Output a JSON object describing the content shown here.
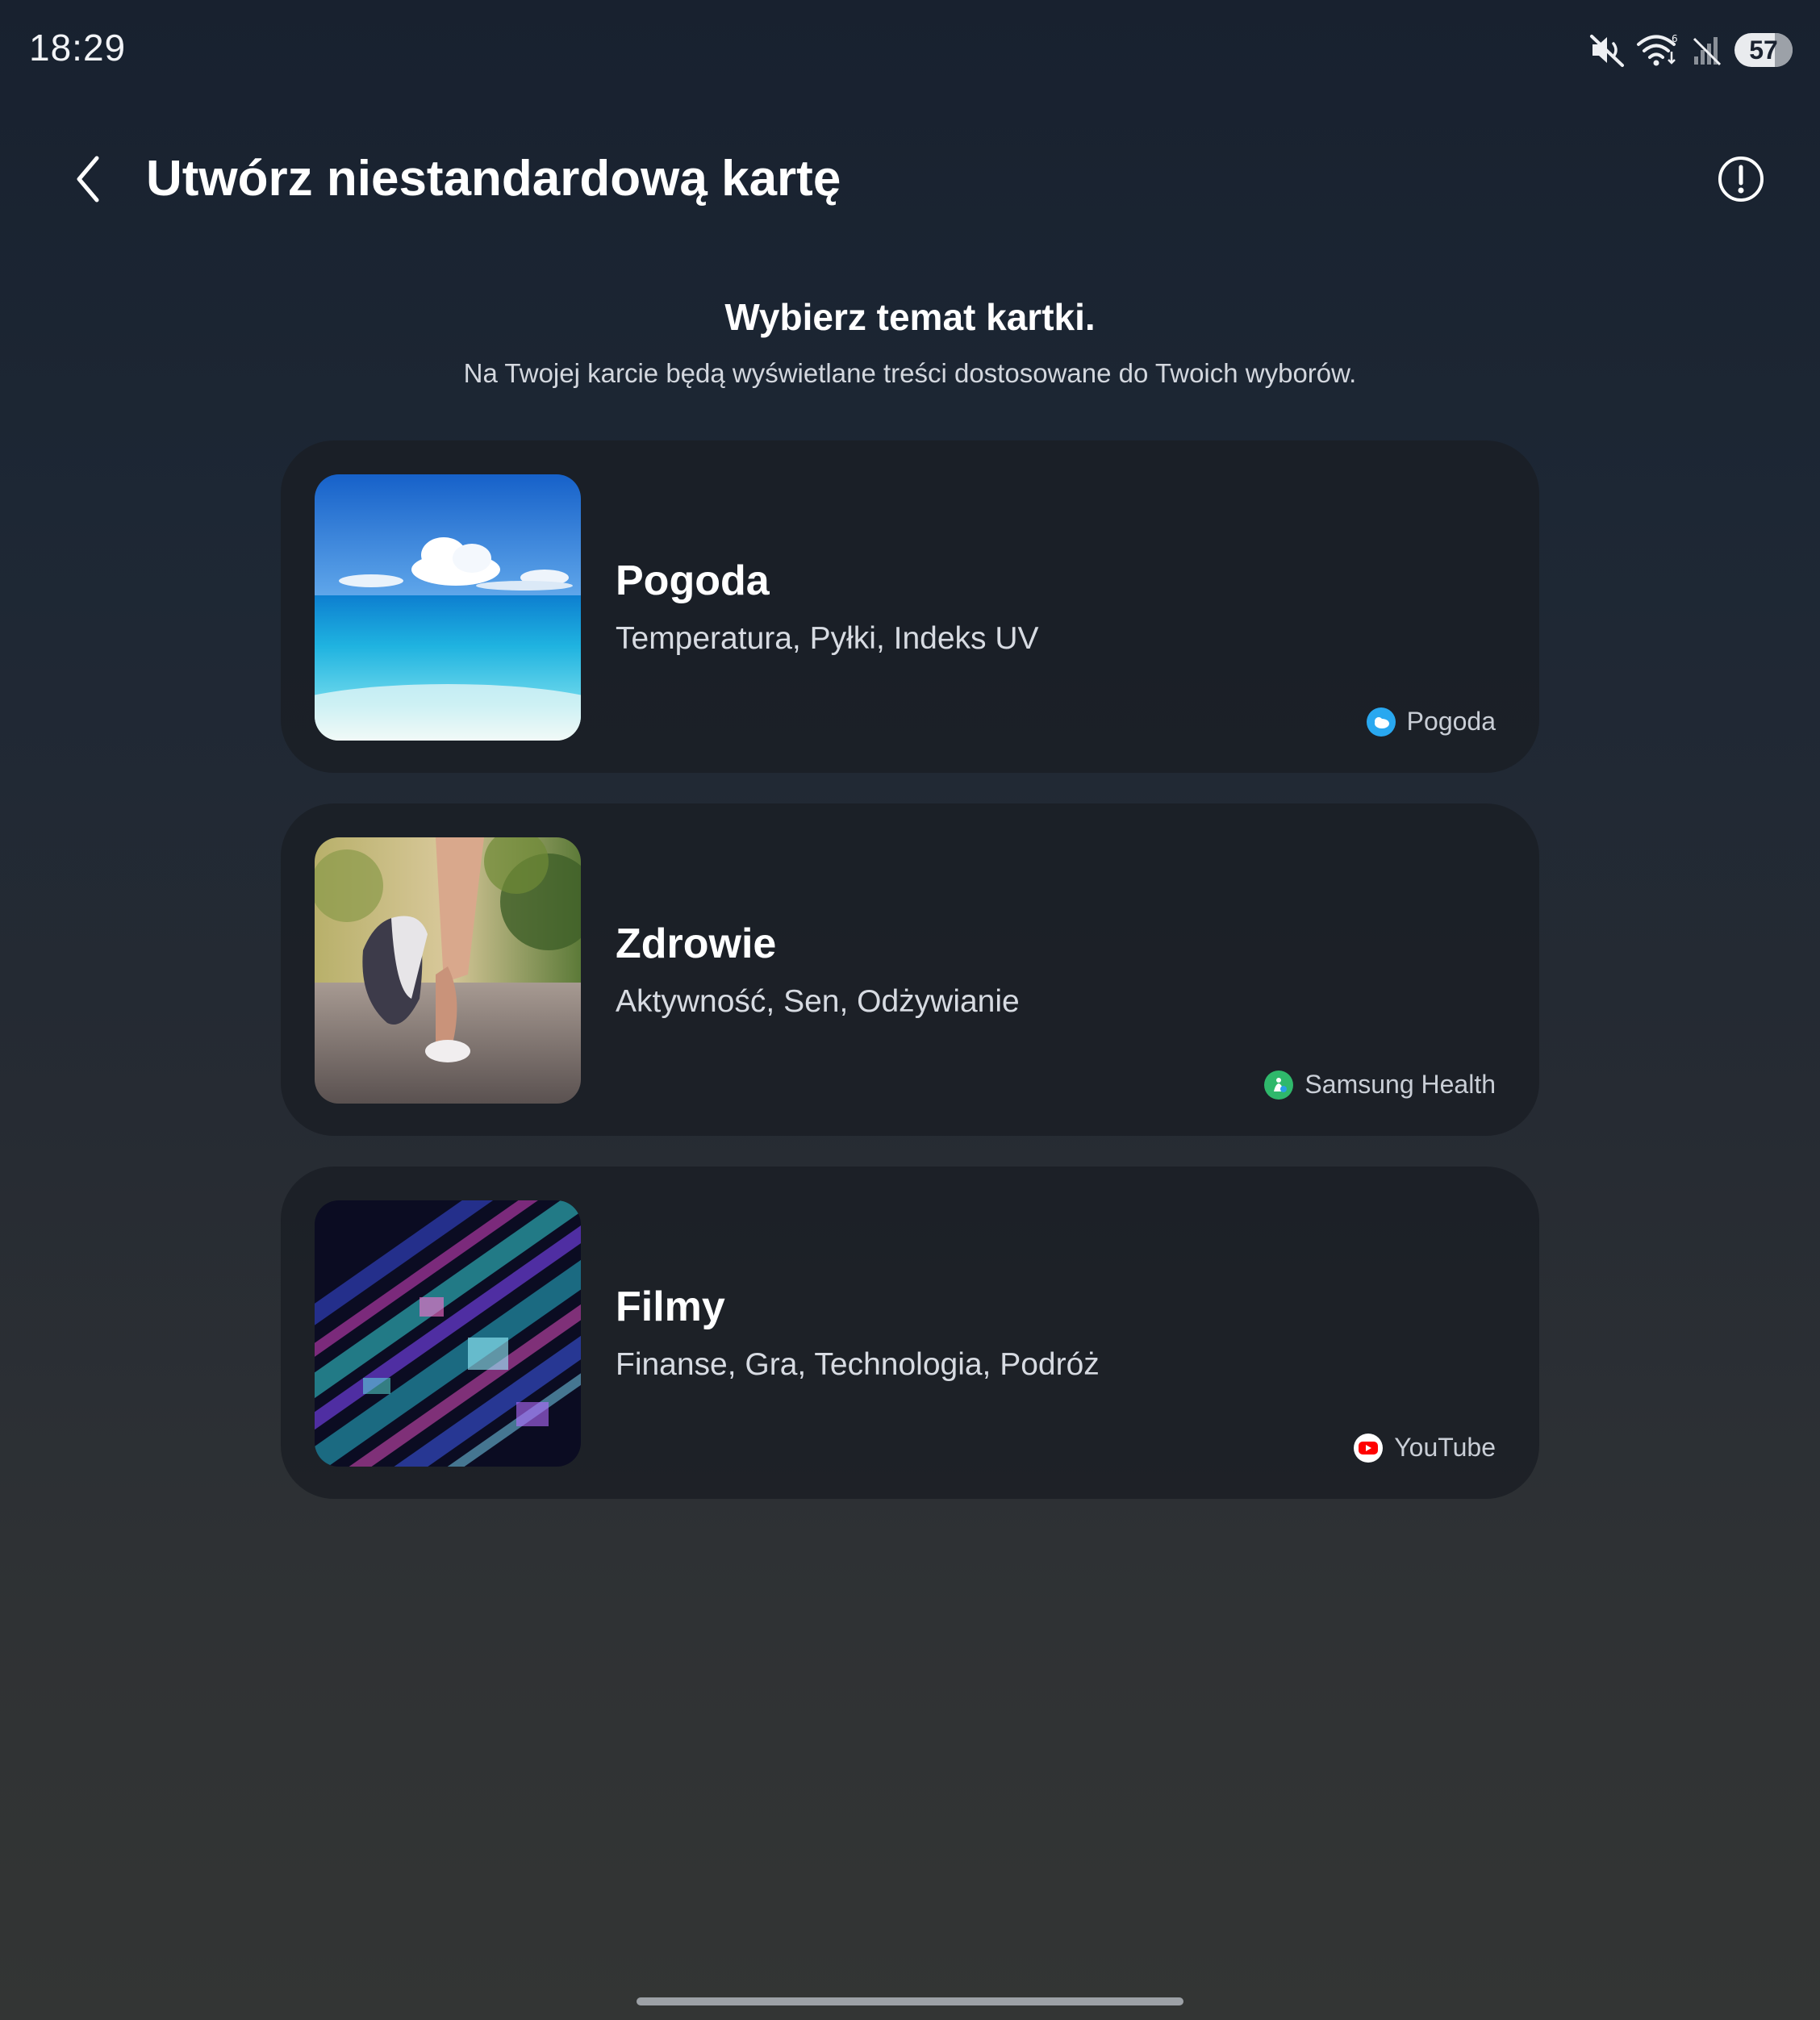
{
  "status_bar": {
    "time": "18:29",
    "battery_level": "57",
    "icons": [
      "mute-icon",
      "wifi-icon",
      "no-signal-icon",
      "battery-icon"
    ]
  },
  "header": {
    "title": "Utwórz niestandardową kartę",
    "back_icon": "chevron-left-icon",
    "info_icon": "info-circle-icon"
  },
  "intro": {
    "title": "Wybierz temat kartki.",
    "subtitle": "Na Twojej karcie będą wyświetlane treści dostosowane do Twoich wyborów."
  },
  "cards": [
    {
      "title": "Pogoda",
      "description": "Temperatura, Pyłki, Indeks UV",
      "source": "Pogoda",
      "source_icon": "weather-app-icon",
      "image": "sea-and-sky-photo"
    },
    {
      "title": "Zdrowie",
      "description": "Aktywność, Sen, Odżywianie",
      "source": "Samsung Health",
      "source_icon": "samsung-health-icon",
      "image": "running-legs-photo"
    },
    {
      "title": "Filmy",
      "description": "Finanse, Gra, Technologia, Podróż",
      "source": "YouTube",
      "source_icon": "youtube-icon",
      "image": "abstract-digital-photo"
    }
  ],
  "colors": {
    "youtube_red": "#ff0000",
    "weather_blue": "#29a8f0",
    "health_green": "#2fb86b"
  }
}
